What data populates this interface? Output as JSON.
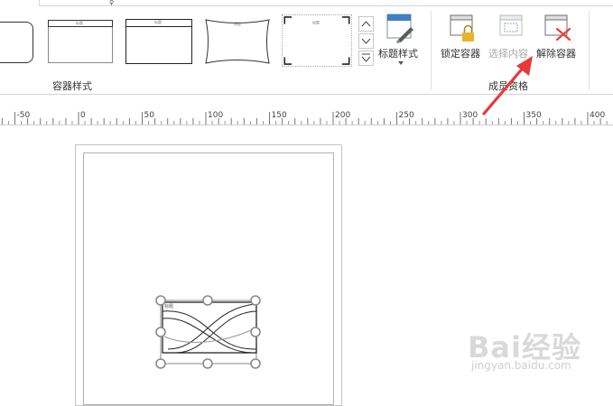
{
  "ribbon": {
    "tab_mark": "♀",
    "container_styles": {
      "group_label": "容器样式",
      "thumb_caption": "标题"
    },
    "title_style_label": "标题样式",
    "membership": {
      "group_label": "成员资格",
      "lock_label": "锁定容器",
      "select_contents_label": "选择内容",
      "disband_label": "解除容器"
    }
  },
  "ruler": {
    "labels": [
      "-50",
      "0",
      "50",
      "100",
      "150",
      "200",
      "250",
      "300",
      "350",
      "400"
    ]
  },
  "canvas": {
    "container_caption": "标题"
  },
  "watermark": {
    "brand": "Bai经验",
    "url": "jingyan.baidu.com"
  },
  "colors": {
    "accent_red": "#e8393a",
    "selection_handle": "#8a8a8a",
    "group_label": "#333333"
  }
}
